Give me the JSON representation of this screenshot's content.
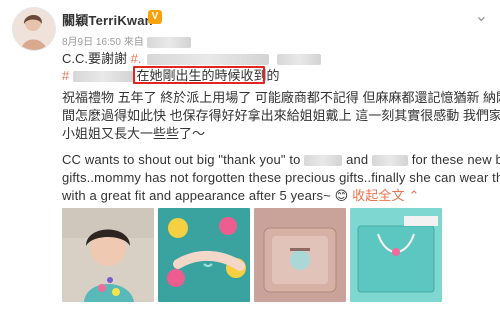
{
  "author": {
    "name": "關穎TerriKwan",
    "verified_badge": "V"
  },
  "meta": {
    "time": "8月9日 16:50",
    "source_prefix": "來自"
  },
  "post": {
    "line1_prefix": "C.C.要謝謝",
    "line1_hashtag_start": "#.",
    "line2_hashtag_start": "#",
    "line2_highlight": "在她剛出生的時候收到的",
    "line3": "祝福禮物 五年了 終於派上用場了 可能廠商都不記得 但麻麻都還記憶猶新 納悶時",
    "line4": "間怎麼過得如此快 也保存得好好拿出來給姐姐戴上 這一刻其實很感動 我們家的",
    "line5": "小姐姐又長大一些些了～",
    "en_line1_a": "CC wants to shout out big \"thank you\" to",
    "en_line1_b": "and",
    "en_line1_c": "for these new born",
    "en_line2": "gifts..mommy has not forgotten these precious gifts..finally she can wear them",
    "en_line3": "with a great fit and appearance after 5 years~",
    "emoji": "😊",
    "expand_label": "收起全文",
    "expand_icon": "chevron-down"
  },
  "photos": [
    {
      "alt": "child-photo"
    },
    {
      "alt": "child-with-necklace"
    },
    {
      "alt": "jewelry-box"
    },
    {
      "alt": "necklace-packaging"
    }
  ],
  "colors": {
    "link": "#eb7350",
    "highlight_border": "#e2261d",
    "badge": "#f7a10b"
  },
  "icons": [
    "chevron-down-icon",
    "verified-badge-icon",
    "menu-chevron-icon"
  ]
}
